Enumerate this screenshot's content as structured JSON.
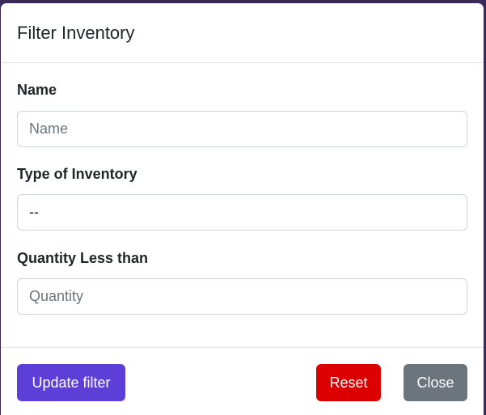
{
  "modal": {
    "title": "Filter Inventory"
  },
  "fields": {
    "name": {
      "label": "Name",
      "placeholder": "Name",
      "value": ""
    },
    "type": {
      "label": "Type of Inventory",
      "selected": "--"
    },
    "quantity": {
      "label": "Quantity Less than",
      "placeholder": "Quantity",
      "value": ""
    }
  },
  "footer": {
    "update_label": "Update filter",
    "reset_label": "Reset",
    "close_label": "Close"
  },
  "colors": {
    "primary": "#5b3fd6",
    "danger": "#dc0000",
    "secondary": "#6c757d"
  }
}
